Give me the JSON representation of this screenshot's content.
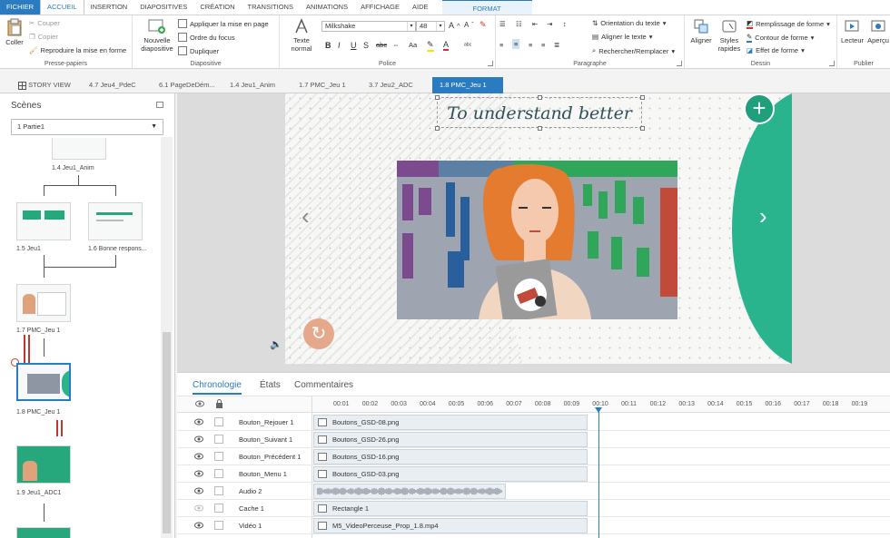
{
  "ribbon_tabs": [
    "FICHIER",
    "ACCUEIL",
    "INSERTION",
    "DIAPOSITIVES",
    "CRÉATION",
    "TRANSITIONS",
    "ANIMATIONS",
    "AFFICHAGE",
    "AIDE",
    "FORMAT"
  ],
  "clipboard": {
    "paste": "Coller",
    "cut": "Couper",
    "copy": "Copier",
    "format_painter": "Reproduire la mise en forme",
    "label": "Presse-papiers"
  },
  "slide_group": {
    "new": "Nouvelle",
    "new2": "diapositive",
    "layout": "Appliquer la mise en page",
    "focus": "Ordre du focus",
    "duplicate": "Dupliquer",
    "label": "Diapositive"
  },
  "font_group": {
    "text_style": "Texte",
    "text_style2": "normal",
    "font": "Milkshake",
    "size": "48",
    "label": "Police",
    "bold": "B",
    "italic": "I",
    "underline": "U",
    "shadow": "S",
    "strike": "abc",
    "aa": "Aa",
    "font_color": "A"
  },
  "paragraph_group": {
    "orientation": "Orientation du texte",
    "align": "Aligner le texte",
    "search": "Rechercher/Remplacer",
    "label": "Paragraphe"
  },
  "drawing_group": {
    "arrange": "Aligner",
    "styles": "Styles",
    "styles2": "rapides",
    "fill": "Remplissage de forme",
    "outline": "Contour de forme",
    "effect": "Effet de forme",
    "label": "Dessin"
  },
  "publish_group": {
    "player": "Lecteur",
    "preview": "Aperçu",
    "label": "Publier"
  },
  "story_tabs": [
    "STORY VIEW",
    "4.7 Jeu4_PdeC",
    "6.1 PageDeDém...",
    "1.4 Jeu1_Anim",
    "1.7 PMC_Jeu 1",
    "3.7 Jeu2_ADC",
    "1.8 PMC_Jeu 1"
  ],
  "scenes": {
    "title": "Scènes",
    "selected": "1 Partie1",
    "labels": [
      "1.4 Jeu1_Anim",
      "1.5 Jeu1",
      "1.6 Bonne respons...",
      "1.7 PMC_Jeu 1",
      "1.8 PMC_Jeu 1",
      "1.9 Jeu1_ADC1"
    ]
  },
  "slide": {
    "title": "To understand better"
  },
  "timeline": {
    "tabs": [
      "Chronologie",
      "États",
      "Commentaires"
    ],
    "ticks": [
      "00:01",
      "00:02",
      "00:03",
      "00:04",
      "00:05",
      "00:06",
      "00:07",
      "00:08",
      "00:09",
      "00:10",
      "00:11",
      "00:12",
      "00:13",
      "00:14",
      "00:15",
      "00:16",
      "00:17",
      "00:18",
      "00:19"
    ],
    "rows": [
      {
        "name": "Bouton_Rejouer 1",
        "bar": "Boutons_GSD-08.png"
      },
      {
        "name": "Bouton_Suivant 1",
        "bar": "Boutons_GSD-26.png"
      },
      {
        "name": "Bouton_Précédent 1",
        "bar": "Boutons_GSD-16.png"
      },
      {
        "name": "Bouton_Menu 1",
        "bar": "Boutons_GSD-03.png"
      },
      {
        "name": "Audio 2",
        "bar": ""
      },
      {
        "name": "Cache 1",
        "bar": "Rectangle 1"
      },
      {
        "name": "Vidéo 1",
        "bar": "M5_VideoPerceuse_Prop_1.8.mp4"
      }
    ]
  },
  "colors": {
    "accent": "#2b7bc0",
    "teal": "#29b48d"
  }
}
